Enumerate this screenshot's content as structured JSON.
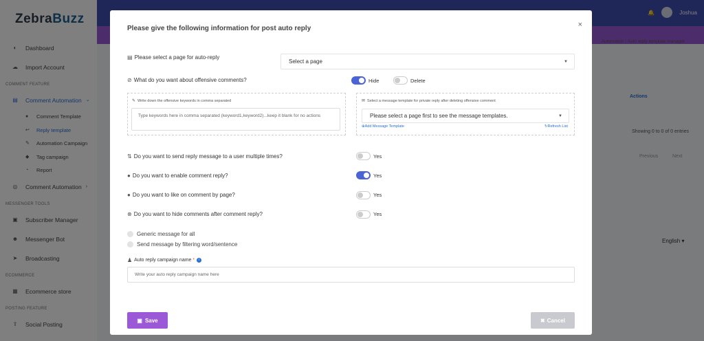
{
  "app": {
    "logo": {
      "part1": "Zebra",
      "part2": "Buzz"
    },
    "sidebar": {
      "items": [
        {
          "label": "Dashboard",
          "icon": "palette-icon"
        },
        {
          "label": "Import Account",
          "icon": "cloud-download-icon"
        }
      ],
      "sections": {
        "comment": "COMMENT FEATURE",
        "messenger": "MESSENGER TOOLS",
        "ecommerce": "ECOMMERCE",
        "posting": "POSTING FEATURE"
      },
      "comment_automation": {
        "label": "Comment Automation",
        "icon": "list-icon"
      },
      "sub_items": [
        {
          "label": "Comment Template"
        },
        {
          "label": "Reply template"
        },
        {
          "label": "Automation Campaign"
        },
        {
          "label": "Tag campaign"
        },
        {
          "label": "Report"
        }
      ],
      "comment_automation_2": {
        "label": "Comment Automation"
      },
      "messenger_items": [
        {
          "label": "Subscriber Manager"
        },
        {
          "label": "Messenger Bot"
        },
        {
          "label": "Broadcasting"
        }
      ],
      "ecommerce_items": [
        {
          "label": "Ecommerce store"
        }
      ],
      "posting_items": [
        {
          "label": "Social Posting"
        }
      ]
    },
    "topbar": {
      "user": "Joshua"
    },
    "breadcrumb": "Automation  /  Auto reply template manager",
    "table": {
      "actions_header": "Actions",
      "showing": "Showing 0 to 0 of 0 entries",
      "previous": "Previous",
      "next": "Next"
    },
    "language": "English"
  },
  "modal": {
    "title": "Please give the following information for post auto reply",
    "close": "×",
    "page_select_label": "Please select a page for auto-reply",
    "page_select_value": "Select a page",
    "offensive_label": "What do you want about offensive comments?",
    "hide_label": "Hide",
    "delete_label": "Delete",
    "hide_on": true,
    "delete_on": false,
    "keywords_label": "Write down the offensive keywords in comma separated",
    "keywords_placeholder": "Type keywords here in comma separated (keyword1,keyword2)...keep it blank for no actions",
    "template_label": "Select a message template for private reply after deleting offensive comment",
    "template_value": "Please select a page first to see the message templates.",
    "add_template": "Add Message Template",
    "refresh_list": "Refresh List",
    "questions": [
      {
        "label": "Do you want to send reply message to a user multiple times?",
        "answer": "Yes",
        "on": false
      },
      {
        "label": "Do you want to enable comment reply?",
        "answer": "Yes",
        "on": true
      },
      {
        "label": "Do you want to like on comment by page?",
        "answer": "Yes",
        "on": false
      },
      {
        "label": "Do you want to hide comments after comment reply?",
        "answer": "Yes",
        "on": false
      }
    ],
    "radio_generic": "Generic message for all",
    "radio_filter": "Send message by filtering word/sentence",
    "campaign_label": "Auto reply campaign name",
    "campaign_required": "*",
    "campaign_placeholder": "Write your auto reply campaign name here",
    "save": "Save",
    "cancel": "Cancel"
  },
  "colors": {
    "accent": "#9b59d8",
    "primary": "#3f4fb0",
    "toggle_on": "#4a64d6",
    "link": "#2a6fd6"
  }
}
